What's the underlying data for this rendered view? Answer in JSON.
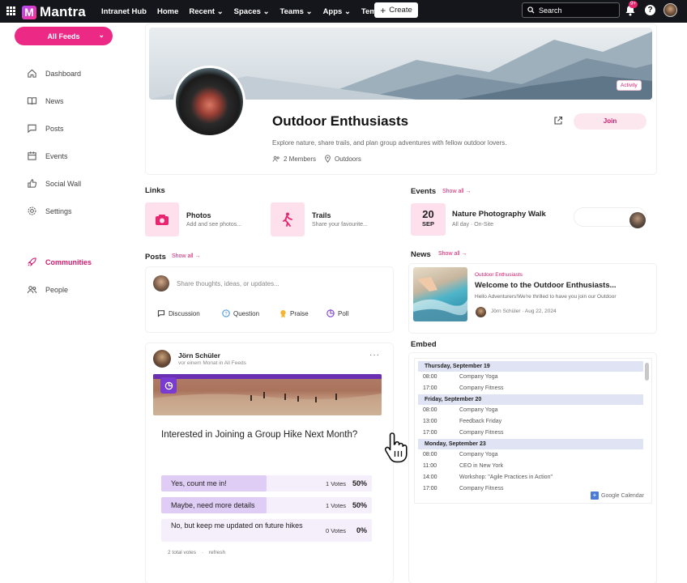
{
  "topbar": {
    "logo_text": "Mantra",
    "nav": [
      "Intranet Hub",
      "Home",
      "Recent",
      "Spaces",
      "Teams",
      "Apps",
      "Templates"
    ],
    "create_label": "Create",
    "search_placeholder": "Search",
    "notifications_badge": "9+"
  },
  "sidebar": {
    "feed_selector": "All Feeds",
    "items": [
      {
        "label": "Dashboard",
        "icon": "home-icon"
      },
      {
        "label": "News",
        "icon": "book-icon"
      },
      {
        "label": "Posts",
        "icon": "chat-icon"
      },
      {
        "label": "Events",
        "icon": "calendar-icon"
      },
      {
        "label": "Social Wall",
        "icon": "thumbs-up-icon"
      },
      {
        "label": "Settings",
        "icon": "gear-icon"
      },
      {
        "label": "Communities",
        "icon": "rocket-icon",
        "active": true
      },
      {
        "label": "People",
        "icon": "people-icon"
      }
    ]
  },
  "group": {
    "activity_label": "Activity",
    "title": "Outdoor Enthusiasts",
    "join_label": "Join",
    "description": "Explore nature, share trails, and plan group adventures with fellow outdoor lovers.",
    "members": "2 Members",
    "category": "Outdoors"
  },
  "links": {
    "title": "Links",
    "items": [
      {
        "name": "Photos",
        "sub": "Add and see photos..."
      },
      {
        "name": "Trails",
        "sub": "Share your favourite..."
      }
    ]
  },
  "events": {
    "title": "Events",
    "show_all": "Show all →",
    "item": {
      "day": "20",
      "month": "SEP",
      "title": "Nature Photography Walk",
      "sub": "All day  ·  On-Site"
    }
  },
  "posts": {
    "title": "Posts",
    "show_all": "Show all →",
    "composer_placeholder": "Share thoughts, ideas, or updates...",
    "types": [
      "Discussion",
      "Question",
      "Praise",
      "Poll"
    ]
  },
  "news": {
    "title": "News",
    "show_all": "Show all →",
    "item": {
      "category": "Outdoor Enthusiasts",
      "title": "Welcome to the Outdoor Enthusiasts...",
      "excerpt": "Hello Adventurers!We're thrilled to have you join our Outdoor",
      "author": "Jörn Schüler",
      "date": "Aug 22, 2024"
    }
  },
  "post": {
    "author": "Jörn Schüler",
    "time": "vor einem Monat in All Feeds",
    "more": "···",
    "question": "Interested in Joining a Group Hike Next Month?",
    "options": [
      {
        "label": "Yes, count me in!",
        "votes": "1 Votes",
        "pct": "50%",
        "fill": 0.5
      },
      {
        "label": "Maybe, need more details",
        "votes": "1 Votes",
        "pct": "50%",
        "fill": 0.5
      },
      {
        "label": "No, but keep me updated on future hikes",
        "votes": "0 Votes",
        "pct": "0%",
        "fill": 0
      }
    ],
    "total_votes": "2 total votes",
    "refresh": "refresh"
  },
  "embed": {
    "title": "Embed",
    "days": [
      {
        "label": "Thursday, September 19",
        "events": [
          [
            "08:00",
            "Company Yoga"
          ],
          [
            "17:00",
            "Company Fitness"
          ]
        ]
      },
      {
        "label": "Friday, September 20",
        "events": [
          [
            "08:00",
            "Company Yoga"
          ],
          [
            "13:00",
            "Feedback Friday"
          ],
          [
            "17:00",
            "Company Fitness"
          ]
        ]
      },
      {
        "label": "Monday, September 23",
        "events": [
          [
            "08:00",
            "Company Yoga"
          ],
          [
            "11:00",
            "CEO in New York"
          ],
          [
            "14:00",
            "Workshop: \"Agile Practices in Action\""
          ],
          [
            "17:00",
            "Company Fitness"
          ]
        ]
      }
    ],
    "footer": "Google Calendar"
  },
  "colors": {
    "accent": "#ec2a86",
    "topbar": "#15151c",
    "poll": "#7a3bd0"
  }
}
